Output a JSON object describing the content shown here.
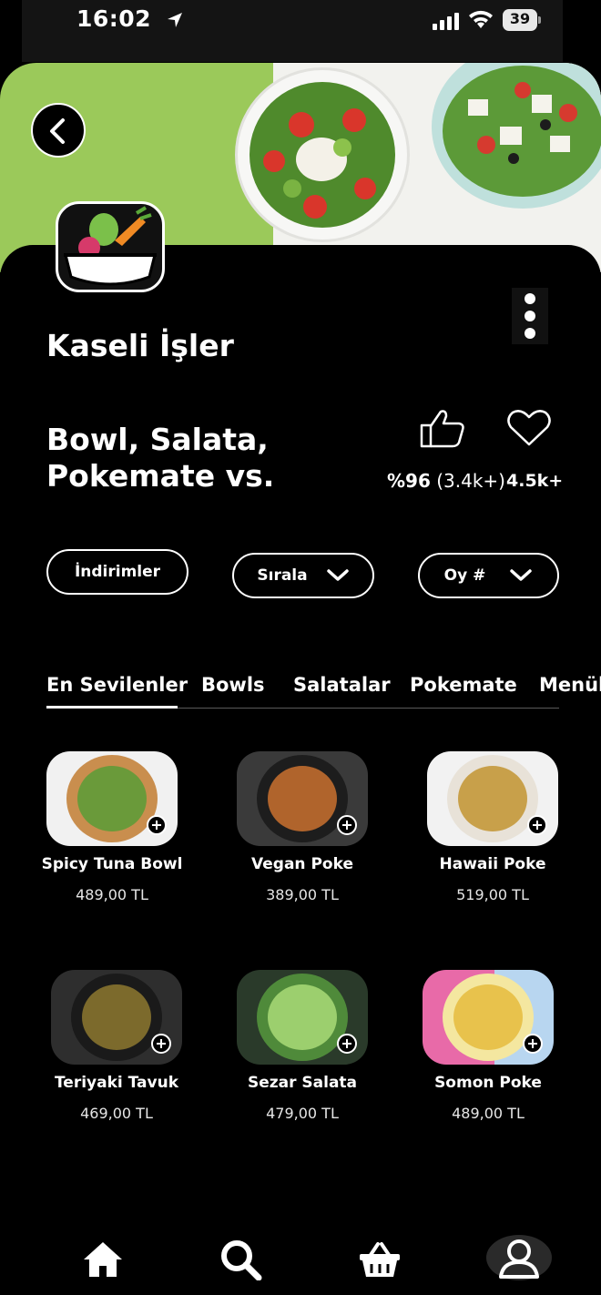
{
  "status_bar": {
    "time": "16:02",
    "battery": "39"
  },
  "store": {
    "name": "Kaseli İşler",
    "description": "Bowl, Salata, Pokemate vs.",
    "rating_percent": "%96",
    "rating_count": "(3.4k+)",
    "favorites": "4.5k+"
  },
  "filters": {
    "discounts": "İndirimler",
    "sort": "Sırala",
    "vote": "Oy #"
  },
  "tabs": [
    "En Sevilenler",
    "Bowls",
    "Salatalar",
    "Pokemate",
    "Menüler"
  ],
  "active_tab": "En Sevilenler",
  "products": [
    {
      "name": "Spicy Tuna Bowl",
      "price": "489,00 TL"
    },
    {
      "name": "Vegan Poke",
      "price": "389,00 TL"
    },
    {
      "name": "Hawaii Poke",
      "price": "519,00 TL"
    },
    {
      "name": "Teriyaki Tavuk",
      "price": "469,00 TL"
    },
    {
      "name": "Sezar Salata",
      "price": "479,00 TL"
    },
    {
      "name": "Somon Poke",
      "price": "489,00 TL"
    }
  ],
  "bottom_nav": [
    "home-icon",
    "search-icon",
    "basket-icon",
    "profile-icon"
  ],
  "colors": {
    "background": "#000000",
    "hero_green": "#9bc95a",
    "text": "#ffffff"
  }
}
